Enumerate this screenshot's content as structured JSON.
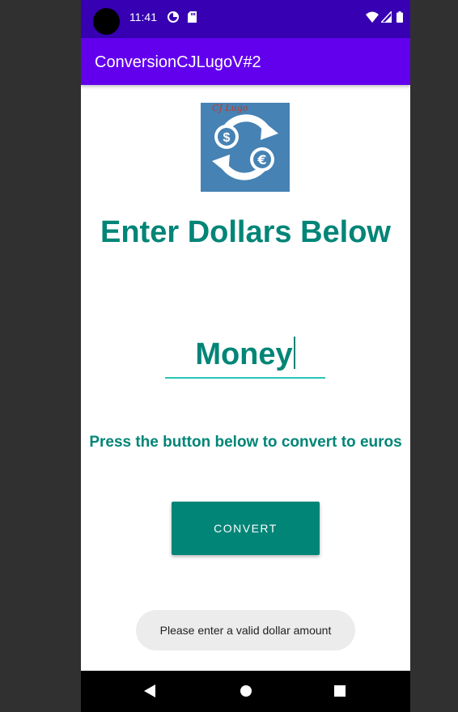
{
  "status_bar": {
    "time": "11:41",
    "icons": [
      "camera-cutout",
      "data-saver-icon",
      "sd-card-icon",
      "wifi-icon",
      "signal-icon",
      "battery-icon"
    ]
  },
  "app_bar": {
    "title": "ConversionCJLugoV#2"
  },
  "logo": {
    "text": "CJ Lugo",
    "icon": "dollar-euro-exchange-icon",
    "background": "#4682b4"
  },
  "main": {
    "heading": "Enter Dollars Below",
    "money_input": {
      "value": "",
      "placeholder": "Money"
    },
    "instruction": "Press the button below to convert to euros",
    "convert_button_label": "CONVERT"
  },
  "toast": {
    "message": "Please enter a valid dollar amount"
  },
  "nav_bar": {
    "buttons": [
      "back-icon",
      "home-icon",
      "recents-icon"
    ]
  },
  "colors": {
    "status_bar": "#3700b3",
    "app_bar": "#6200ee",
    "accent": "#008577",
    "underline": "#26c6b6",
    "toast_bg": "#ececec"
  }
}
